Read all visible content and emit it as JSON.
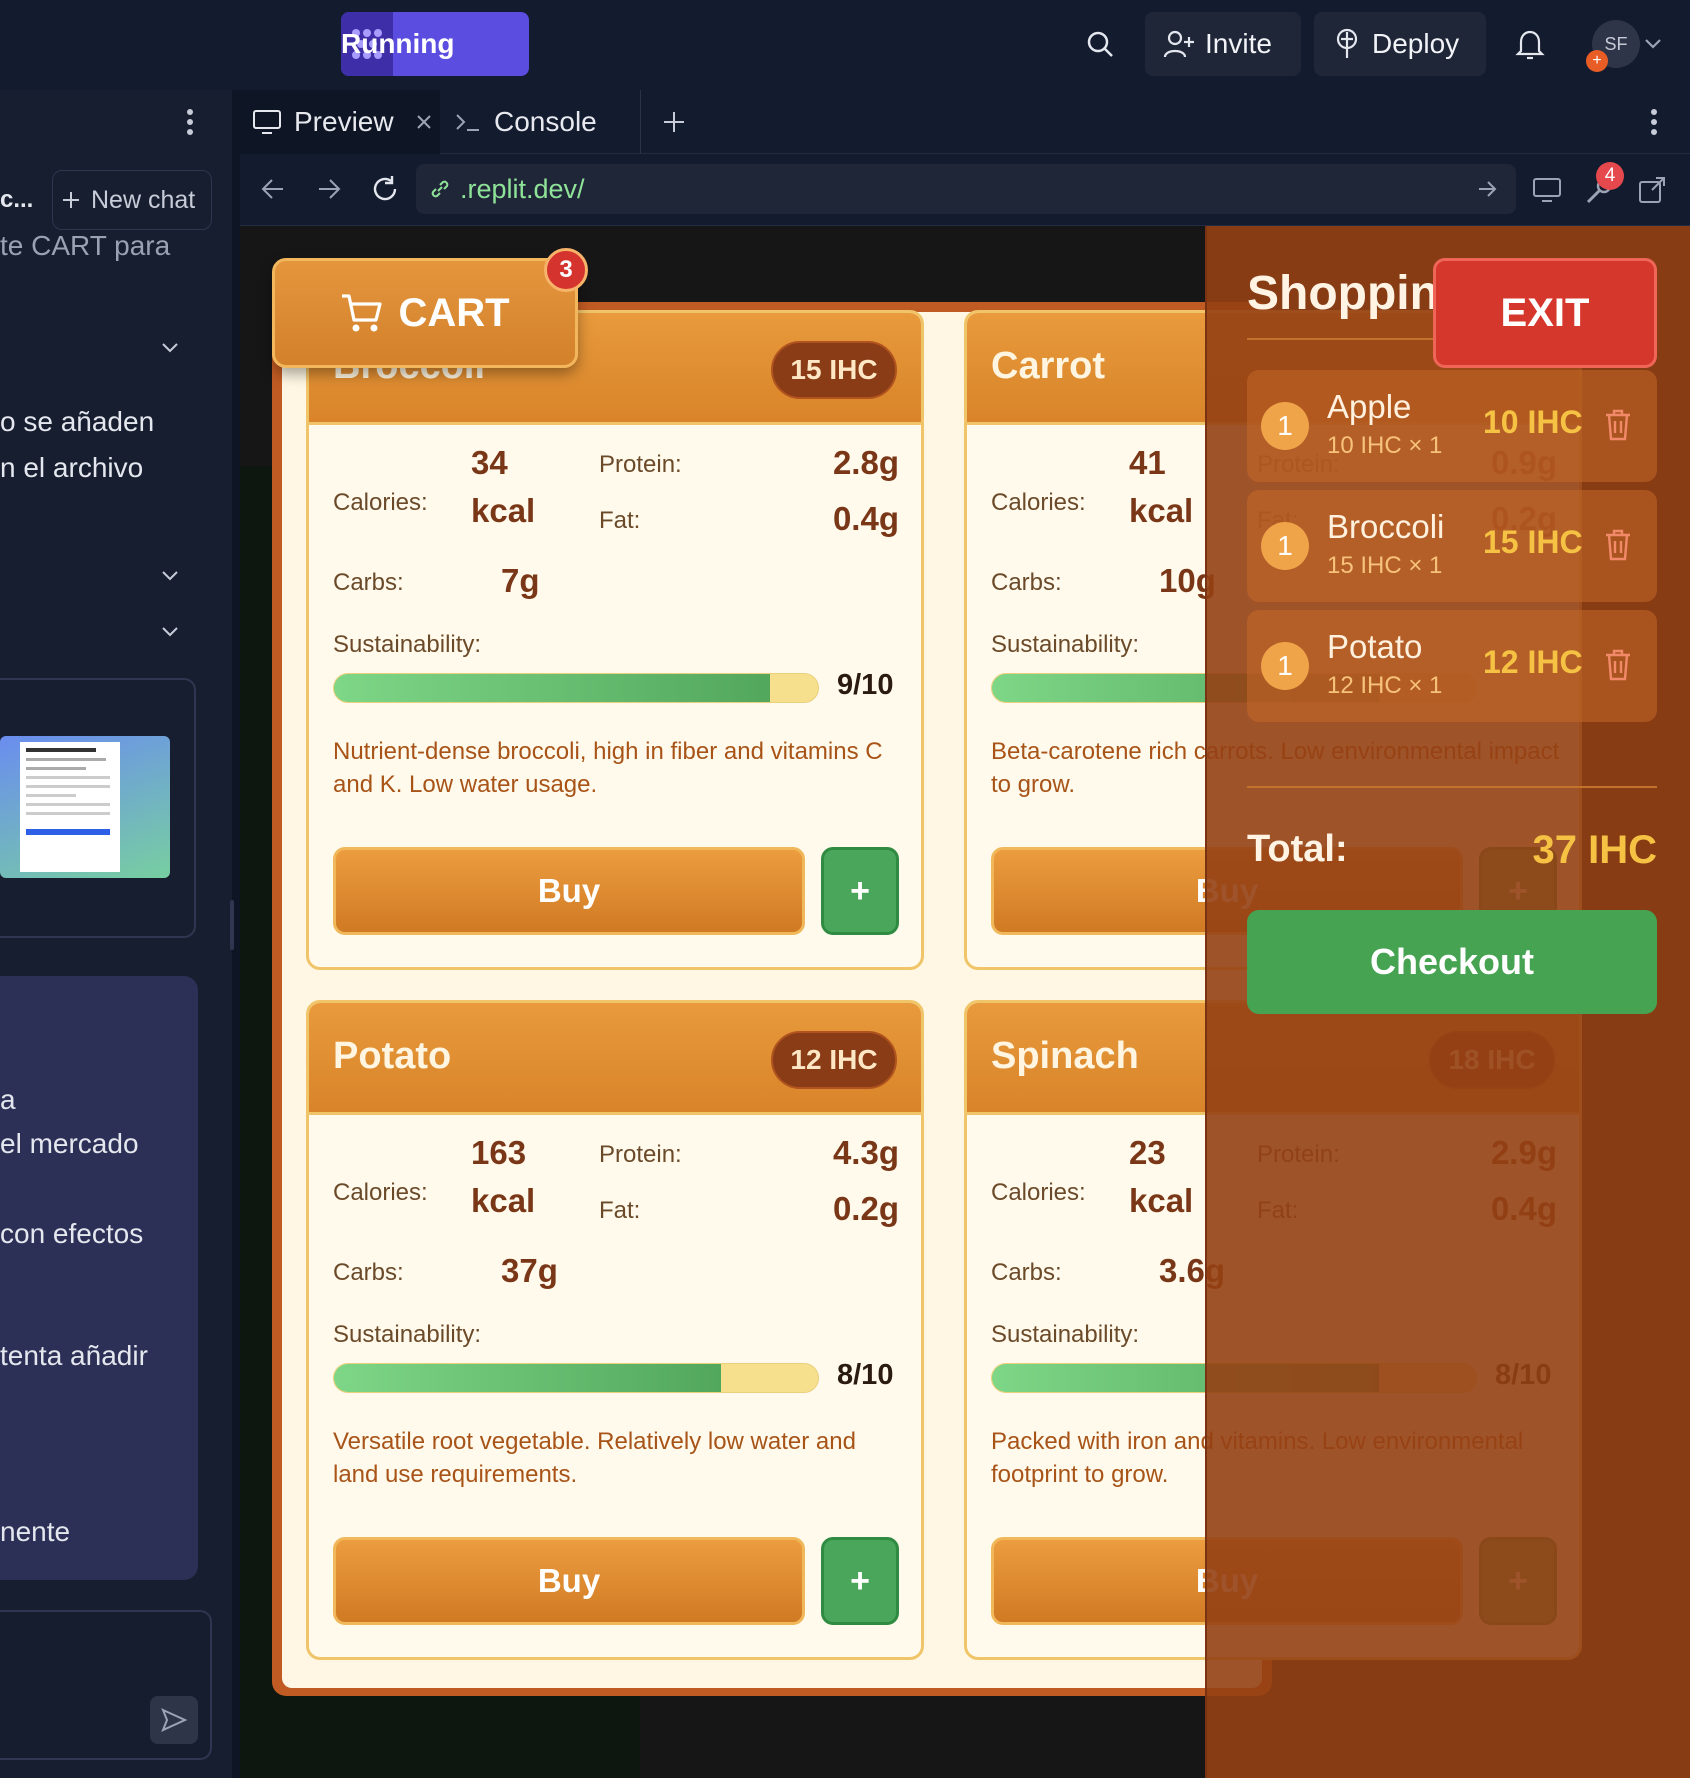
{
  "topbar": {
    "run_label": "Running",
    "invite_label": "Invite",
    "deploy_label": "Deploy",
    "avatar_initials": "SF",
    "avatar_badge": "+"
  },
  "left_panel": {
    "header_fragment": "c...",
    "new_chat_label": "New chat",
    "lines": [
      "te CART para",
      "o se añaden",
      "n el archivo",
      "a",
      "el mercado",
      "con efectos",
      "tenta añadir",
      "nente"
    ]
  },
  "tabs": {
    "preview": "Preview",
    "console": "Console"
  },
  "browser": {
    "url": ".replit.dev/",
    "tools_badge": "4"
  },
  "app": {
    "cart_label": "CART",
    "cart_count": "3",
    "cards": [
      {
        "name": "Broccoli",
        "price": "15 IHC",
        "calories_label": "Calories:",
        "calories_value": "34",
        "calories_unit": "kcal",
        "protein_label": "Protein:",
        "protein_value": "2.8g",
        "fat_label": "Fat:",
        "fat_value": "0.4g",
        "carbs_label": "Carbs:",
        "carbs_value": "7g",
        "sustainability_label": "Sustainability:",
        "sustainability_score": "9/10",
        "sustainability_fraction": 0.9,
        "description": "Nutrient-dense broccoli, high in fiber and vitamins C and K. Low water usage.",
        "buy_label": "Buy",
        "plus_label": "+"
      },
      {
        "name": "Carrot",
        "price": "",
        "calories_label": "Calories:",
        "calories_value": "41",
        "calories_unit": "kcal",
        "protein_label": "Protein:",
        "protein_value": "0.9g",
        "fat_label": "Fat:",
        "fat_value": "0.2g",
        "carbs_label": "Carbs:",
        "carbs_value": "10g",
        "sustainability_label": "Sustainability:",
        "sustainability_score": "",
        "sustainability_fraction": 0.8,
        "description": "Beta-carotene rich carrots. Low environmental impact to grow.",
        "buy_label": "Buy",
        "plus_label": "+"
      },
      {
        "name": "Potato",
        "price": "12 IHC",
        "calories_label": "Calories:",
        "calories_value": "163",
        "calories_unit": "kcal",
        "protein_label": "Protein:",
        "protein_value": "4.3g",
        "fat_label": "Fat:",
        "fat_value": "0.2g",
        "carbs_label": "Carbs:",
        "carbs_value": "37g",
        "sustainability_label": "Sustainability:",
        "sustainability_score": "8/10",
        "sustainability_fraction": 0.8,
        "description": "Versatile root vegetable. Relatively low water and land use requirements.",
        "buy_label": "Buy",
        "plus_label": "+"
      },
      {
        "name": "Spinach",
        "price": "18 IHC",
        "calories_label": "Calories:",
        "calories_value": "23",
        "calories_unit": "kcal",
        "protein_label": "Protein:",
        "protein_value": "2.9g",
        "fat_label": "Fat:",
        "fat_value": "0.4g",
        "carbs_label": "Carbs:",
        "carbs_value": "3.6g",
        "sustainability_label": "Sustainability:",
        "sustainability_score": "8/10",
        "sustainability_fraction": 0.8,
        "description": "Packed with iron and vitamins. Low environmental footprint to grow.",
        "buy_label": "Buy",
        "plus_label": "+"
      }
    ],
    "sidebar": {
      "title": "Shoppin",
      "exit_label": "EXIT",
      "items": [
        {
          "qty": "1",
          "name": "Apple",
          "sub": "10 IHC × 1",
          "price": "10 IHC"
        },
        {
          "qty": "1",
          "name": "Broccoli",
          "sub": "15 IHC × 1",
          "price": "15 IHC"
        },
        {
          "qty": "1",
          "name": "Potato",
          "sub": "12 IHC × 1",
          "price": "12 IHC"
        }
      ],
      "total_label": "Total:",
      "total_value": "37 IHC",
      "checkout_label": "Checkout"
    }
  }
}
